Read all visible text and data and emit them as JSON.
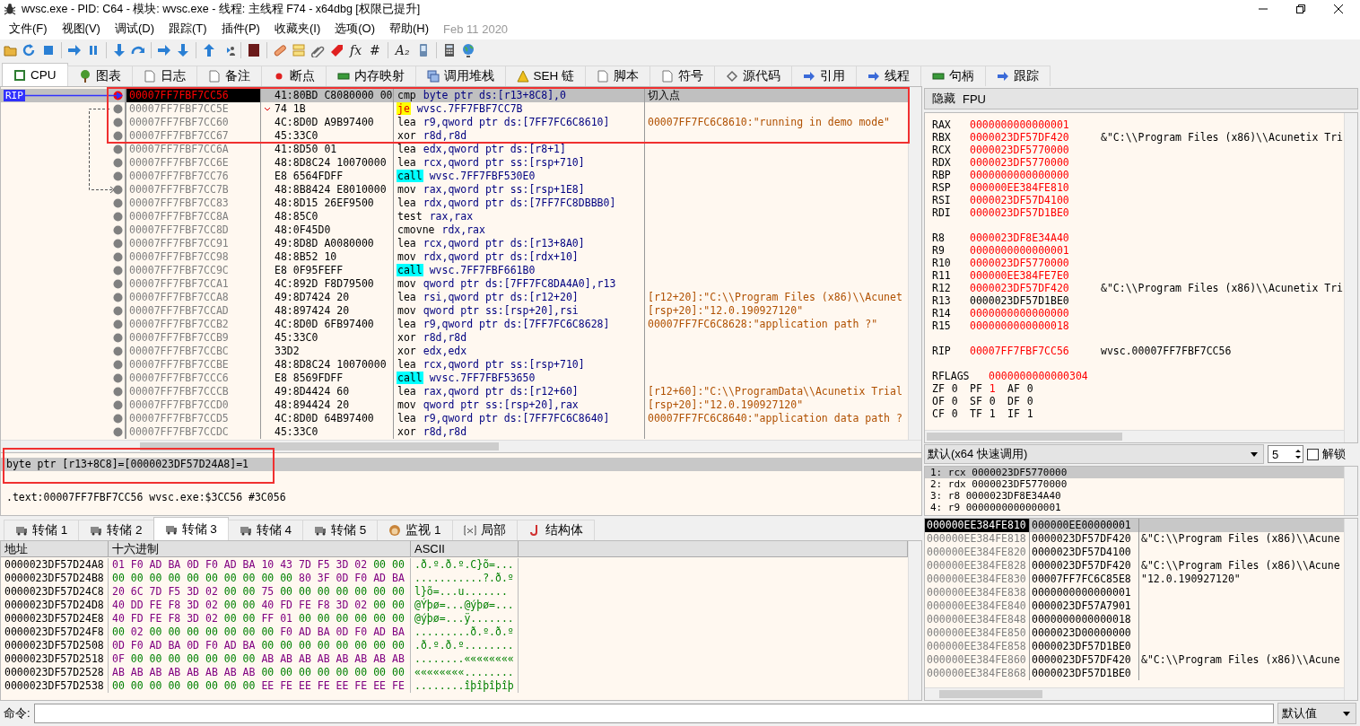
{
  "window": {
    "title": "wvsc.exe - PID: C64 - 模块: wvsc.exe - 线程: 主线程 F74 - x64dbg [权限已提升]"
  },
  "menu": {
    "items": [
      "文件(F)",
      "视图(V)",
      "调试(D)",
      "跟踪(T)",
      "插件(P)",
      "收藏夹(I)",
      "选项(O)",
      "帮助(H)"
    ],
    "build_date": "Feb 11 2020"
  },
  "toolbar": [
    {
      "kind": "folder"
    },
    {
      "kind": "restart"
    },
    {
      "kind": "stop"
    },
    {
      "kind": "separator"
    },
    {
      "kind": "arrow-right"
    },
    {
      "kind": "pause"
    },
    {
      "kind": "separator"
    },
    {
      "kind": "arrow-down"
    },
    {
      "kind": "curve"
    },
    {
      "kind": "separator"
    },
    {
      "kind": "arrow-right"
    },
    {
      "kind": "arrow-down"
    },
    {
      "kind": "separator"
    },
    {
      "kind": "arrow-up"
    },
    {
      "kind": "person"
    },
    {
      "kind": "separator"
    },
    {
      "kind": "square"
    },
    {
      "kind": "separator"
    },
    {
      "kind": "bandage"
    },
    {
      "kind": "note"
    },
    {
      "kind": "clip"
    },
    {
      "kind": "tag"
    },
    {
      "kind": "glyph",
      "text": "fx"
    },
    {
      "kind": "glyph",
      "text": "#"
    },
    {
      "kind": "separator"
    },
    {
      "kind": "glyph",
      "text": "A₂"
    },
    {
      "kind": "phone"
    },
    {
      "kind": "separator"
    },
    {
      "kind": "calculator"
    },
    {
      "kind": "globe"
    }
  ],
  "tabs": [
    {
      "label": "CPU",
      "kind": "chip",
      "selected": true
    },
    {
      "label": "图表",
      "kind": "tree",
      "selected": false
    },
    {
      "label": "日志",
      "kind": "page",
      "selected": false
    },
    {
      "label": "备注",
      "kind": "page",
      "selected": false
    },
    {
      "label": "断点",
      "kind": "dot",
      "selected": false
    },
    {
      "label": "内存映射",
      "kind": "bar",
      "selected": false
    },
    {
      "label": "调用堆栈",
      "kind": "stack",
      "selected": false
    },
    {
      "label": "SEH 链",
      "kind": "warning",
      "selected": false
    },
    {
      "label": "脚本",
      "kind": "page",
      "selected": false
    },
    {
      "label": "符号",
      "kind": "page",
      "selected": false
    },
    {
      "label": "源代码",
      "kind": "diamond",
      "selected": false
    },
    {
      "label": "引用",
      "kind": "arrow",
      "selected": false
    },
    {
      "label": "线程",
      "kind": "arrow",
      "selected": false
    },
    {
      "label": "句柄",
      "kind": "bar",
      "selected": false
    },
    {
      "label": "跟踪",
      "kind": "arrow",
      "selected": false
    }
  ],
  "disassembly": {
    "annotated": true,
    "rip_label": "RIP",
    "rows": [
      {
        "address": "00007FF7FBF7CC56",
        "bytes": "41:80BD C8080000 00",
        "mnemonic": "cmp",
        "operands": "byte ptr ds:[r13+8C8],0",
        "kind": "plain",
        "comment": "切入点",
        "selected": true,
        "rip": true,
        "breakpoint": true,
        "jump_source": false,
        "jump_target": false
      },
      {
        "address": "00007FF7FBF7CC5E",
        "bytes": "74 1B",
        "mnemonic": "je",
        "operands": "wvsc.7FF7FBF7CC7B",
        "kind": "jump",
        "selected": false,
        "rip": false,
        "breakpoint": false,
        "jump_source": true,
        "jump_target": false
      },
      {
        "address": "00007FF7FBF7CC60",
        "bytes": "4C:8D0D A9B97400",
        "mnemonic": "lea",
        "operands": "r9,qword ptr ds:[7FF7FC6C8610]",
        "kind": "plain",
        "comment": "00007FF7FC6C8610:\"running in demo mode\"",
        "selected": false,
        "rip": false,
        "breakpoint": false,
        "jump_source": false,
        "jump_target": false
      },
      {
        "address": "00007FF7FBF7CC67",
        "bytes": "45:33C0",
        "mnemonic": "xor",
        "operands": "r8d,r8d",
        "kind": "plain",
        "selected": false,
        "rip": false,
        "breakpoint": false,
        "jump_source": false,
        "jump_target": false
      },
      {
        "address": "00007FF7FBF7CC6A",
        "bytes": "41:8D50 01",
        "mnemonic": "lea",
        "operands": "edx,qword ptr ds:[r8+1]",
        "kind": "plain",
        "selected": false,
        "rip": false,
        "breakpoint": false,
        "jump_source": false,
        "jump_target": false
      },
      {
        "address": "00007FF7FBF7CC6E",
        "bytes": "48:8D8C24 10070000",
        "mnemonic": "lea",
        "operands": "rcx,qword ptr ss:[rsp+710]",
        "kind": "plain",
        "selected": false,
        "rip": false,
        "breakpoint": false,
        "jump_source": false,
        "jump_target": false
      },
      {
        "address": "00007FF7FBF7CC76",
        "bytes": "E8 6564FDFF",
        "mnemonic": "call",
        "operands": "wvsc.7FF7FBF530E0",
        "kind": "call",
        "selected": false,
        "rip": false,
        "breakpoint": false,
        "jump_source": false,
        "jump_target": false
      },
      {
        "address": "00007FF7FBF7CC7B",
        "bytes": "48:8B8424 E8010000",
        "mnemonic": "mov",
        "operands": "rax,qword ptr ss:[rsp+1E8]",
        "kind": "plain",
        "selected": false,
        "rip": false,
        "breakpoint": false,
        "jump_source": false,
        "jump_target": true
      },
      {
        "address": "00007FF7FBF7CC83",
        "bytes": "48:8D15 26EF9500",
        "mnemonic": "lea",
        "operands": "rdx,qword ptr ds:[7FF7FC8DBBB0]",
        "kind": "plain",
        "selected": false,
        "rip": false,
        "breakpoint": false,
        "jump_source": false,
        "jump_target": false
      },
      {
        "address": "00007FF7FBF7CC8A",
        "bytes": "48:85C0",
        "mnemonic": "test",
        "operands": "rax,rax",
        "kind": "plain",
        "selected": false,
        "rip": false,
        "breakpoint": false,
        "jump_source": false,
        "jump_target": false
      },
      {
        "address": "00007FF7FBF7CC8D",
        "bytes": "48:0F45D0",
        "mnemonic": "cmovne",
        "operands": "rdx,rax",
        "kind": "plain",
        "selected": false,
        "rip": false,
        "breakpoint": false,
        "jump_source": false,
        "jump_target": false
      },
      {
        "address": "00007FF7FBF7CC91",
        "bytes": "49:8D8D A0080000",
        "mnemonic": "lea",
        "operands": "rcx,qword ptr ds:[r13+8A0]",
        "kind": "plain",
        "selected": false,
        "rip": false,
        "breakpoint": false,
        "jump_source": false,
        "jump_target": false
      },
      {
        "address": "00007FF7FBF7CC98",
        "bytes": "48:8B52 10",
        "mnemonic": "mov",
        "operands": "rdx,qword ptr ds:[rdx+10]",
        "kind": "plain",
        "selected": false,
        "rip": false,
        "breakpoint": false,
        "jump_source": false,
        "jump_target": false
      },
      {
        "address": "00007FF7FBF7CC9C",
        "bytes": "E8 0F95FEFF",
        "mnemonic": "call",
        "operands": "wvsc.7FF7FBF661B0",
        "kind": "call",
        "selected": false,
        "rip": false,
        "breakpoint": false,
        "jump_source": false,
        "jump_target": false
      },
      {
        "address": "00007FF7FBF7CCA1",
        "bytes": "4C:892D F8D79500",
        "mnemonic": "mov",
        "operands": "qword ptr ds:[7FF7FC8DA4A0],r13",
        "kind": "plain",
        "selected": false,
        "rip": false,
        "breakpoint": false,
        "jump_source": false,
        "jump_target": false
      },
      {
        "address": "00007FF7FBF7CCA8",
        "bytes": "49:8D7424 20",
        "mnemonic": "lea",
        "operands": "rsi,qword ptr ds:[r12+20]",
        "kind": "plain",
        "comment": "[r12+20]:\"C:\\\\Program Files (x86)\\\\Acunet",
        "selected": false,
        "rip": false,
        "breakpoint": false,
        "jump_source": false,
        "jump_target": false
      },
      {
        "address": "00007FF7FBF7CCAD",
        "bytes": "48:897424 20",
        "mnemonic": "mov",
        "operands": "qword ptr ss:[rsp+20],rsi",
        "kind": "plain",
        "comment": "[rsp+20]:\"12.0.190927120\"",
        "selected": false,
        "rip": false,
        "breakpoint": false,
        "jump_source": false,
        "jump_target": false
      },
      {
        "address": "00007FF7FBF7CCB2",
        "bytes": "4C:8D0D 6FB97400",
        "mnemonic": "lea",
        "operands": "r9,qword ptr ds:[7FF7FC6C8628]",
        "kind": "plain",
        "comment": "00007FF7FC6C8628:\"application path ?\"",
        "selected": false,
        "rip": false,
        "breakpoint": false,
        "jump_source": false,
        "jump_target": false
      },
      {
        "address": "00007FF7FBF7CCB9",
        "bytes": "45:33C0",
        "mnemonic": "xor",
        "operands": "r8d,r8d",
        "kind": "plain",
        "selected": false,
        "rip": false,
        "breakpoint": false,
        "jump_source": false,
        "jump_target": false
      },
      {
        "address": "00007FF7FBF7CCBC",
        "bytes": "33D2",
        "mnemonic": "xor",
        "operands": "edx,edx",
        "kind": "plain",
        "selected": false,
        "rip": false,
        "breakpoint": false,
        "jump_source": false,
        "jump_target": false
      },
      {
        "address": "00007FF7FBF7CCBE",
        "bytes": "48:8D8C24 10070000",
        "mnemonic": "lea",
        "operands": "rcx,qword ptr ss:[rsp+710]",
        "kind": "plain",
        "selected": false,
        "rip": false,
        "breakpoint": false,
        "jump_source": false,
        "jump_target": false
      },
      {
        "address": "00007FF7FBF7CCC6",
        "bytes": "E8 8569FDFF",
        "mnemonic": "call",
        "operands": "wvsc.7FF7FBF53650",
        "kind": "call",
        "selected": false,
        "rip": false,
        "breakpoint": false,
        "jump_source": false,
        "jump_target": false
      },
      {
        "address": "00007FF7FBF7CCCB",
        "bytes": "49:8D4424 60",
        "mnemonic": "lea",
        "operands": "rax,qword ptr ds:[r12+60]",
        "kind": "plain",
        "comment": "[r12+60]:\"C:\\\\ProgramData\\\\Acunetix Trial",
        "selected": false,
        "rip": false,
        "breakpoint": false,
        "jump_source": false,
        "jump_target": false
      },
      {
        "address": "00007FF7FBF7CCD0",
        "bytes": "48:894424 20",
        "mnemonic": "mov",
        "operands": "qword ptr ss:[rsp+20],rax",
        "kind": "plain",
        "comment": "[rsp+20]:\"12.0.190927120\"",
        "selected": false,
        "rip": false,
        "breakpoint": false,
        "jump_source": false,
        "jump_target": false
      },
      {
        "address": "00007FF7FBF7CCD5",
        "bytes": "4C:8D0D 64B97400",
        "mnemonic": "lea",
        "operands": "r9,qword ptr ds:[7FF7FC6C8640]",
        "kind": "plain",
        "comment": "00007FF7FC6C8640:\"application data path ?",
        "selected": false,
        "rip": false,
        "breakpoint": false,
        "jump_source": false,
        "jump_target": false
      },
      {
        "address": "00007FF7FBF7CCDC",
        "bytes": "45:33C0",
        "mnemonic": "xor",
        "operands": "r8d,r8d",
        "kind": "plain",
        "selected": false,
        "rip": false,
        "breakpoint": false,
        "jump_source": false,
        "jump_target": false
      }
    ]
  },
  "registers": {
    "header": [
      "隐藏",
      "FPU"
    ],
    "groups": [
      [
        {
          "name": "RAX",
          "value": "0000000000000001",
          "changed": true
        },
        {
          "name": "RBX",
          "value": "0000023DF57DF420",
          "comment": "&\"C:\\\\Program Files (x86)\\\\Acunetix Tri",
          "changed": true
        },
        {
          "name": "RCX",
          "value": "0000023DF5770000",
          "changed": true
        },
        {
          "name": "RDX",
          "value": "0000023DF5770000",
          "changed": true
        },
        {
          "name": "RBP",
          "value": "0000000000000000",
          "changed": true
        },
        {
          "name": "RSP",
          "value": "000000EE384FE810",
          "changed": true
        },
        {
          "name": "RSI",
          "value": "0000023DF57D4100",
          "changed": true
        },
        {
          "name": "RDI",
          "value": "0000023DF57D1BE0",
          "changed": true
        }
      ],
      [
        {
          "name": "R8",
          "value": "0000023DF8E34A40",
          "changed": true
        },
        {
          "name": "R9",
          "value": "0000000000000001",
          "changed": true
        },
        {
          "name": "R10",
          "value": "0000023DF5770000",
          "changed": true
        },
        {
          "name": "R11",
          "value": "000000EE384FE7E0",
          "changed": true
        },
        {
          "name": "R12",
          "value": "0000023DF57DF420",
          "comment": "&\"C:\\\\Program Files (x86)\\\\Acunetix Tri",
          "changed": true
        },
        {
          "name": "R13",
          "value": "0000023DF57D1BE0",
          "changed": false
        },
        {
          "name": "R14",
          "value": "0000000000000000",
          "changed": true
        },
        {
          "name": "R15",
          "value": "0000000000000018",
          "changed": true
        }
      ],
      [
        {
          "name": "RIP",
          "value": "00007FF7FBF7CC56",
          "comment": "wvsc.00007FF7FBF7CC56",
          "changed": true
        }
      ]
    ],
    "rflags": {
      "name": "RFLAGS",
      "value": "0000000000000304",
      "changed": true
    },
    "flags": [
      {
        "name": "ZF",
        "value": "0",
        "changed": false
      },
      {
        "name": "PF",
        "value": "1",
        "changed": true
      },
      {
        "name": "AF",
        "value": "0",
        "changed": false
      },
      {
        "name": "OF",
        "value": "0",
        "changed": false
      },
      {
        "name": "SF",
        "value": "0",
        "changed": false
      },
      {
        "name": "DF",
        "value": "0",
        "changed": false
      },
      {
        "name": "CF",
        "value": "0",
        "changed": false
      },
      {
        "name": "TF",
        "value": "1",
        "changed": false
      },
      {
        "name": "IF",
        "value": "1",
        "changed": false
      }
    ]
  },
  "info": {
    "annotated": true,
    "lines": [
      "byte ptr [r13+8C8]=[0000023DF57D24A8]=1",
      ".text:00007FF7FBF7CC56 wvsc.exe:$3CC56 #3C056"
    ]
  },
  "dump": {
    "tabs": [
      {
        "label": "转储 1",
        "kind": "truck",
        "selected": false
      },
      {
        "label": "转储 2",
        "kind": "truck",
        "selected": false
      },
      {
        "label": "转储 3",
        "kind": "truck",
        "selected": true
      },
      {
        "label": "转储 4",
        "kind": "truck",
        "selected": false
      },
      {
        "label": "转储 5",
        "kind": "truck",
        "selected": false
      },
      {
        "label": "监视 1",
        "kind": "face",
        "selected": false
      },
      {
        "label": "局部",
        "kind": "var",
        "selected": false
      },
      {
        "label": "结构体",
        "kind": "hook",
        "selected": false
      }
    ],
    "columns": [
      "地址",
      "十六进制",
      "ASCII"
    ],
    "rows": [
      {
        "address": "0000023DF57D24A8",
        "hex": "01 F0 AD BA 0D F0 AD BA 10 43 7D F5 3D 02 00 00",
        "ascii": ".ð.º.ð.º.C}õ=..."
      },
      {
        "address": "0000023DF57D24B8",
        "hex": "00 00 00 00 00 00 00 00 00 00 80 3F 0D F0 AD BA",
        "ascii": "...........?.ð.º"
      },
      {
        "address": "0000023DF57D24C8",
        "hex": "20 6C 7D F5 3D 02 00 00 75 00 00 00 00 00 00 00",
        "ascii": " l}õ=...u......."
      },
      {
        "address": "0000023DF57D24D8",
        "hex": "40 DD FE F8 3D 02 00 00 40 FD FE F8 3D 02 00 00",
        "ascii": "@Ýþø=...@ýþø=..."
      },
      {
        "address": "0000023DF57D24E8",
        "hex": "40 FD FE F8 3D 02 00 00 FF 01 00 00 00 00 00 00",
        "ascii": "@ýþø=...ÿ......."
      },
      {
        "address": "0000023DF57D24F8",
        "hex": "00 02 00 00 00 00 00 00 00 F0 AD BA 0D F0 AD BA",
        "ascii": ".........ð.º.ð.º"
      },
      {
        "address": "0000023DF57D2508",
        "hex": "0D F0 AD BA 0D F0 AD BA 00 00 00 00 00 00 00 00",
        "ascii": ".ð.º.ð.º........"
      },
      {
        "address": "0000023DF57D2518",
        "hex": "0F 00 00 00 00 00 00 00 AB AB AB AB AB AB AB AB",
        "ascii": "........««««««««"
      },
      {
        "address": "0000023DF57D2528",
        "hex": "AB AB AB AB AB AB AB AB 00 00 00 00 00 00 00 00",
        "ascii": "««««««««........"
      },
      {
        "address": "0000023DF57D2538",
        "hex": "00 00 00 00 00 00 00 00 EE FE EE FE EE FE EE FE",
        "ascii": "........îþîþîþîþ"
      }
    ]
  },
  "arguments": {
    "convention": "默认(x64 快速调用)",
    "count": "5",
    "unlock": {
      "label": "解锁",
      "checked": false
    },
    "items": [
      "1: rcx 0000023DF5770000",
      "2: rdx 0000023DF5770000",
      "3: r8 0000023DF8E34A40",
      "4: r9 0000000000000001"
    ]
  },
  "stack": {
    "rows": [
      {
        "address": "000000EE384FE810",
        "value": "000000EE00000001",
        "selected": true
      },
      {
        "address": "000000EE384FE818",
        "value": "0000023DF57DF420",
        "comment": "&\"C:\\\\Program Files (x86)\\\\Acune",
        "selected": false
      },
      {
        "address": "000000EE384FE820",
        "value": "0000023DF57D4100",
        "selected": false
      },
      {
        "address": "000000EE384FE828",
        "value": "0000023DF57DF420",
        "comment": "&\"C:\\\\Program Files (x86)\\\\Acune",
        "selected": false
      },
      {
        "address": "000000EE384FE830",
        "value": "00007FF7FC6C85E8",
        "comment": "\"12.0.190927120\"",
        "selected": false
      },
      {
        "address": "000000EE384FE838",
        "value": "0000000000000001",
        "selected": false
      },
      {
        "address": "000000EE384FE840",
        "value": "0000023DF57A7901",
        "selected": false
      },
      {
        "address": "000000EE384FE848",
        "value": "0000000000000018",
        "selected": false
      },
      {
        "address": "000000EE384FE850",
        "value": "0000023D00000000",
        "selected": false
      },
      {
        "address": "000000EE384FE858",
        "value": "0000023DF57D1BE0",
        "selected": false
      },
      {
        "address": "000000EE384FE860",
        "value": "0000023DF57DF420",
        "comment": "&\"C:\\\\Program Files (x86)\\\\Acune",
        "selected": false
      },
      {
        "address": "000000EE384FE868",
        "value": "0000023DF57D1BE0",
        "selected": false
      }
    ]
  },
  "command": {
    "label": "命令:",
    "mode": "默认值"
  }
}
